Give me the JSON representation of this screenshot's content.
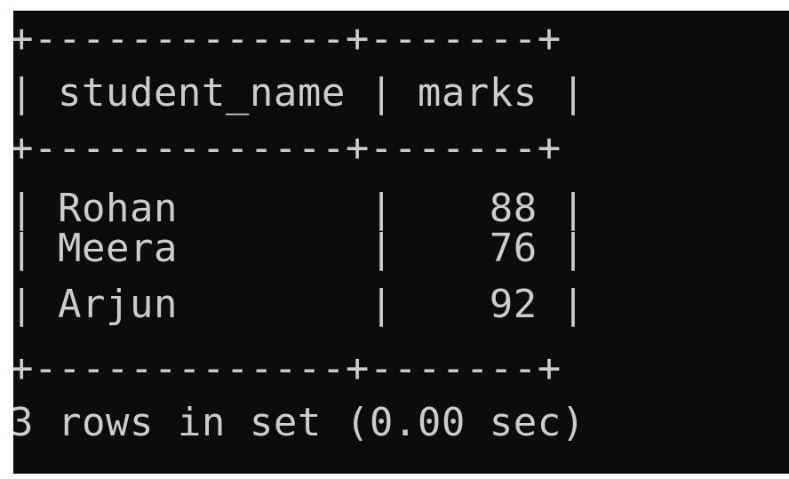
{
  "terminal": {
    "output_lines": [
      "+-------------+-------+",
      "| student_name | marks |",
      "+-------------+-------+",
      "| Rohan        |    88 |",
      "| Meera        |    76 |",
      "| Arjun        |    92 |",
      "+-------------+-------+",
      "3 rows in set (0.00 sec)"
    ],
    "colors": {
      "background": "#0c0c0c",
      "text": "#cccccc"
    }
  }
}
